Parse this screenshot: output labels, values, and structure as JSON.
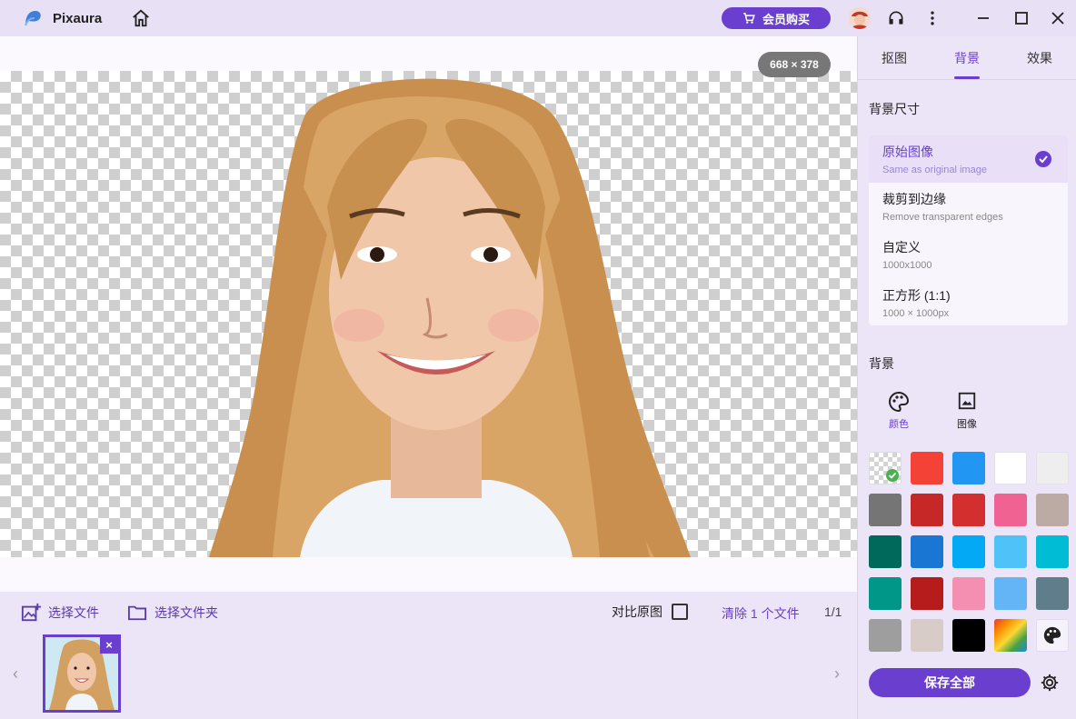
{
  "app": {
    "name": "Pixaura"
  },
  "titlebar": {
    "vip_label": "会员购买"
  },
  "canvas": {
    "dimensions": "668 × 378"
  },
  "bottom": {
    "select_file": "选择文件",
    "select_folder": "选择文件夹",
    "compare_label": "对比原图",
    "clear_label": "清除 1 个文件",
    "page": "1/1"
  },
  "panel": {
    "tabs": [
      "抠图",
      "背景",
      "效果"
    ],
    "active_tab": "背景",
    "size_title": "背景尺寸",
    "size_options": [
      {
        "title": "原始图像",
        "sub": "Same as original image",
        "selected": true
      },
      {
        "title": "裁剪到边缘",
        "sub": "Remove transparent edges",
        "selected": false
      },
      {
        "title": "自定义",
        "sub": "1000x1000",
        "selected": false
      },
      {
        "title": "正方形 (1:1)",
        "sub": "1000 × 1000px",
        "selected": false
      }
    ],
    "bg_title": "背景",
    "bg_types": [
      {
        "label": "颜色",
        "icon": "palette-icon",
        "active": true
      },
      {
        "label": "图像",
        "icon": "image-icon",
        "active": false
      }
    ],
    "swatches": [
      "transparent",
      "#f44336",
      "#2196f3",
      "#ffffff",
      "#eeeeee",
      "#757575",
      "#c62828",
      "#d32f2f",
      "#f06292",
      "#bcaaa4",
      "#00695c",
      "#1976d2",
      "#03a9f4",
      "#4fc3f7",
      "#00bcd4",
      "#009688",
      "#b71c1c",
      "#f48fb1",
      "#64b5f6",
      "#607d8b",
      "#9e9e9e",
      "#d7ccc8",
      "#000000",
      "rainbow",
      "palette"
    ],
    "save_label": "保存全部"
  },
  "colors": {
    "accent": "#6a3fd0"
  }
}
